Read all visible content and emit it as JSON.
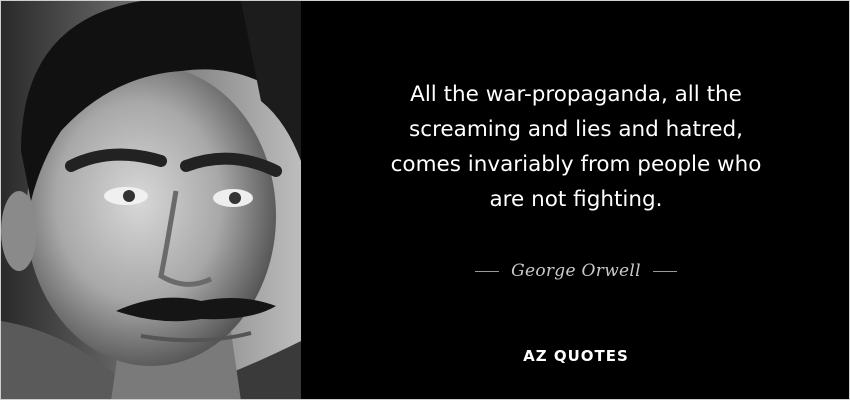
{
  "quote": {
    "text": "All the war-propaganda, all the\nscreaming and lies and hatred,\ncomes invariably from people who\nare not fighting."
  },
  "author": {
    "name": "George Orwell"
  },
  "brand": {
    "logo_text": "AZ QUOTES"
  },
  "colors": {
    "background": "#000000",
    "quote_text": "#ffffff",
    "author_text": "#c9c9c9"
  }
}
